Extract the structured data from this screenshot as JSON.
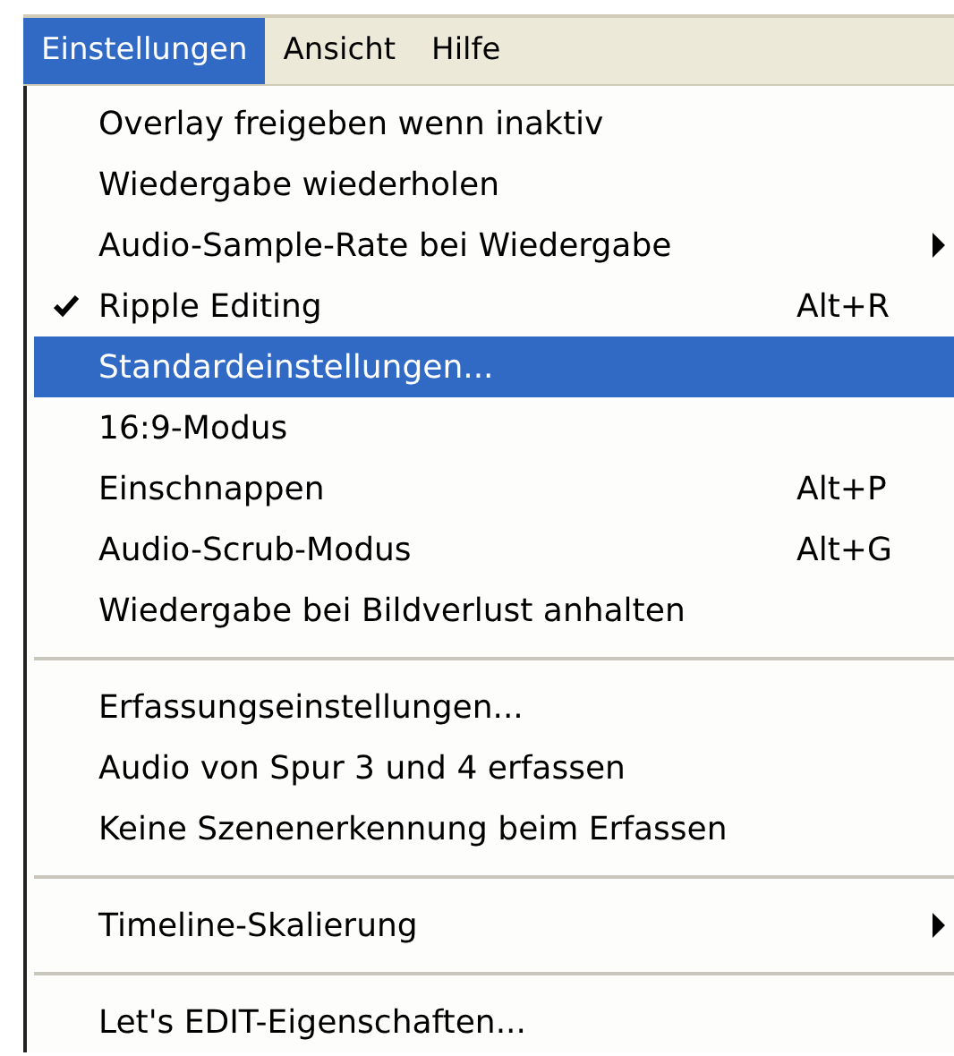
{
  "menubar": [
    {
      "label": "Einstellungen",
      "selected": true
    },
    {
      "label": "Ansicht",
      "selected": false
    },
    {
      "label": "Hilfe",
      "selected": false
    }
  ],
  "menu": [
    {
      "kind": "item",
      "label": "Overlay freigeben wenn inaktiv",
      "checked": false,
      "selected": false,
      "submenu": false
    },
    {
      "kind": "item",
      "label": "Wiedergabe wiederholen",
      "checked": false,
      "selected": false,
      "submenu": false
    },
    {
      "kind": "item",
      "label": "Audio-Sample-Rate bei Wiedergabe",
      "checked": false,
      "selected": false,
      "submenu": true
    },
    {
      "kind": "item",
      "label": "Ripple Editing",
      "shortcut": "Alt+R",
      "checked": true,
      "selected": false,
      "submenu": false
    },
    {
      "kind": "item",
      "label": "Standardeinstellungen...",
      "checked": false,
      "selected": true,
      "submenu": false
    },
    {
      "kind": "item",
      "label": "16:9-Modus",
      "checked": false,
      "selected": false,
      "submenu": false
    },
    {
      "kind": "item",
      "label": "Einschnappen",
      "shortcut": "Alt+P",
      "checked": false,
      "selected": false,
      "submenu": false
    },
    {
      "kind": "item",
      "label": "Audio-Scrub-Modus",
      "shortcut": "Alt+G",
      "checked": false,
      "selected": false,
      "submenu": false
    },
    {
      "kind": "item",
      "label": "Wiedergabe bei Bildverlust anhalten",
      "checked": false,
      "selected": false,
      "submenu": false
    },
    {
      "kind": "separator"
    },
    {
      "kind": "item",
      "label": "Erfassungseinstellungen...",
      "checked": false,
      "selected": false,
      "submenu": false
    },
    {
      "kind": "item",
      "label": "Audio von Spur 3 und 4 erfassen",
      "checked": false,
      "selected": false,
      "submenu": false
    },
    {
      "kind": "item",
      "label": "Keine Szenenerkennung beim Erfassen",
      "checked": false,
      "selected": false,
      "submenu": false
    },
    {
      "kind": "separator"
    },
    {
      "kind": "item",
      "label": "Timeline-Skalierung",
      "checked": false,
      "selected": false,
      "submenu": true
    },
    {
      "kind": "separator"
    },
    {
      "kind": "item",
      "label": "Let's EDIT-Eigenschaften...",
      "checked": false,
      "selected": false,
      "submenu": false
    }
  ]
}
